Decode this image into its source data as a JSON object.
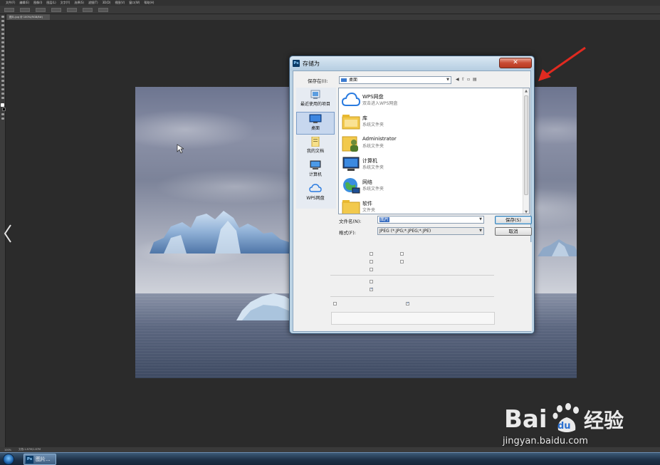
{
  "ps": {
    "menu": [
      "文件(F)",
      "编辑(E)",
      "图像(I)",
      "图层(L)",
      "文字(Y)",
      "选择(S)",
      "滤镜(T)",
      "3D(D)",
      "视图(V)",
      "窗口(W)",
      "帮助(H)"
    ],
    "doc_tab": "图片.jpg @ 100%(RGB/8#)",
    "status": [
      "100%",
      "文档:1.87M/1.87M"
    ]
  },
  "dialog": {
    "title": "存储为",
    "close_label": "✕",
    "lookin_label": "保存在(I):",
    "lookin_value": "桌面",
    "places": [
      {
        "label": "最近使用的项目",
        "icon": "recent-items-icon"
      },
      {
        "label": "桌面",
        "icon": "desktop-icon",
        "selected": true
      },
      {
        "label": "我的文档",
        "icon": "documents-icon"
      },
      {
        "label": "计算机",
        "icon": "computer-icon"
      },
      {
        "label": "WPS网盘",
        "icon": "wps-cloud-icon"
      }
    ],
    "files": [
      {
        "name": "WPS网盘",
        "sub": "双击进入WPS网盘",
        "icon": "wps-cloud-icon"
      },
      {
        "name": "库",
        "sub": "系统文件夹",
        "icon": "library-folder-icon"
      },
      {
        "name": "Administrator",
        "sub": "系统文件夹",
        "icon": "user-folder-icon"
      },
      {
        "name": "计算机",
        "sub": "系统文件夹",
        "icon": "computer-icon"
      },
      {
        "name": "网络",
        "sub": "系统文件夹",
        "icon": "network-icon"
      },
      {
        "name": "软件",
        "sub": "文件夹",
        "icon": "folder-icon"
      }
    ],
    "filename_label": "文件名(N):",
    "filename_value": "图片",
    "format_label": "格式(F):",
    "format_value": "JPEG (*.JPG;*.JPEG;*.JPE)",
    "save_button": "保存(S)",
    "cancel_button": "取消"
  },
  "taskbar": {
    "app_label": "图片..."
  },
  "watermark": {
    "url": "jingyan.baidu.com"
  },
  "colors": {
    "accent_arrow": "#e02a20",
    "selection": "#3b6fc1",
    "baidu_blue": "#ffffff"
  }
}
